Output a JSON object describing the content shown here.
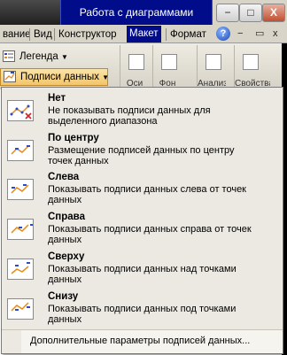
{
  "window": {
    "context_title": "Работа с диаграммами",
    "minimize_label": "−",
    "maximize_label": "□",
    "close_label": "X"
  },
  "tabs": [
    {
      "label": "вание"
    },
    {
      "label": "Вид"
    },
    {
      "label": "Конструктор"
    },
    {
      "label": "Макет",
      "active": true
    },
    {
      "label": "Формат"
    }
  ],
  "tab_row_icons": {
    "help": "?",
    "minimize": "−",
    "restore": "▭",
    "close": "x"
  },
  "ribbon": {
    "legend_label": "Легенда",
    "data_labels_label": "Подписи данных",
    "big_buttons": [
      {
        "label": "Оси",
        "icon": "axes-icon"
      },
      {
        "label": "Фон",
        "icon": "background-icon"
      },
      {
        "label": "Анализ",
        "icon": "analysis-icon"
      },
      {
        "label": "Свойства",
        "icon": "properties-icon"
      }
    ]
  },
  "menu": {
    "items": [
      {
        "title": "Нет",
        "desc": "Не показывать подписи данных для выделенного диапазона",
        "icon": "no-labels-icon"
      },
      {
        "title": "По центру",
        "desc": "Размещение подписей данных по центру точек данных",
        "icon": "center-labels-icon"
      },
      {
        "title": "Слева",
        "desc": "Показывать подписи данных слева от точек данных",
        "icon": "left-labels-icon"
      },
      {
        "title": "Справа",
        "desc": "Показывать подписи данных справа от точек данных",
        "icon": "right-labels-icon"
      },
      {
        "title": "Сверху",
        "desc": "Показывать подписи данных над точками данных",
        "icon": "above-labels-icon"
      },
      {
        "title": "Снизу",
        "desc": "Показывать подписи данных под точками данных",
        "icon": "below-labels-icon"
      }
    ],
    "more_options": "Дополнительные параметры подписей данных..."
  },
  "colors": {
    "context_blue": "#000c8a",
    "menu_background": "#ece9e2",
    "series_line": "#e88a18",
    "series_points": "#2a4cc8"
  }
}
